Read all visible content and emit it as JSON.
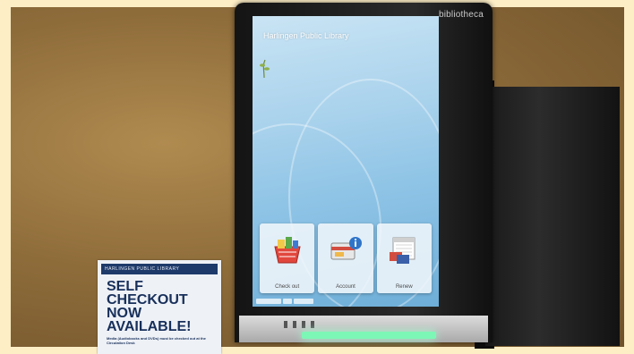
{
  "scene": {
    "kiosk": {
      "brand": "bibliotheca",
      "screen_title": "Harlingen Public Library",
      "tiles": [
        {
          "label": "Check out",
          "icon": "checkout-basket-icon"
        },
        {
          "label": "Account",
          "icon": "account-info-icon"
        },
        {
          "label": "Renew",
          "icon": "renew-calendar-icon"
        }
      ]
    },
    "sign": {
      "header": "HARLINGEN PUBLIC LIBRARY",
      "headline": [
        "SELF",
        "CHECKOUT",
        "NOW",
        "AVAILABLE!"
      ],
      "subtext": "Media (Audiobooks and DVDs) must be checked out at the Circulation Desk"
    },
    "colors": {
      "wall": "#9b7a45",
      "screen": "#a9d2ec",
      "sign_text": "#172f5a",
      "base_light": "#7df7b6"
    }
  }
}
